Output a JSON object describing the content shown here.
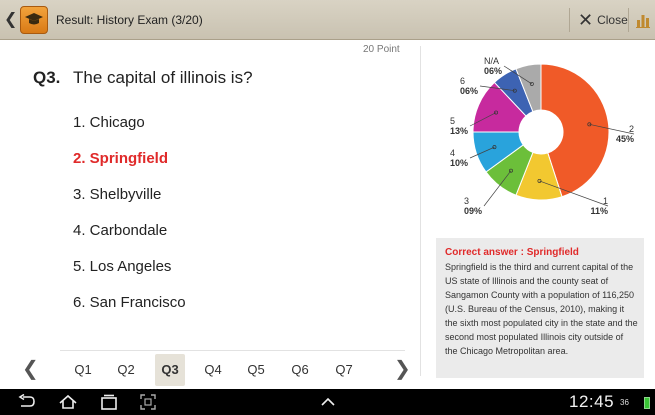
{
  "actionbar": {
    "title": "Result: History Exam (3/20)",
    "close_label": "Close",
    "back_icon": "chevron-left-icon",
    "app_icon": "graduation-cap-icon",
    "close_icon": "x-icon",
    "chart_icon": "bar-chart-icon"
  },
  "question": {
    "points": "20 Point",
    "number": "Q3.",
    "text": "The capital of illinois is?",
    "answers": [
      {
        "label": "1. Chicago",
        "correct": false
      },
      {
        "label": "2. Springfield",
        "correct": true
      },
      {
        "label": "3. Shelbyville",
        "correct": false
      },
      {
        "label": "4. Carbondale",
        "correct": false
      },
      {
        "label": "5. Los Angeles",
        "correct": false
      },
      {
        "label": "6. San Francisco",
        "correct": false
      }
    ]
  },
  "nav": {
    "prev_icon": "chevron-left-icon",
    "next_icon": "chevron-right-icon",
    "items": [
      "Q1",
      "Q2",
      "Q3",
      "Q4",
      "Q5",
      "Q6",
      "Q7"
    ],
    "active_index": 2
  },
  "chart_data": {
    "type": "pie",
    "donut": true,
    "slices": [
      {
        "label": "2",
        "percent_label": "45%",
        "value": 45,
        "color": "#f05a28"
      },
      {
        "label": "1",
        "percent_label": "11%",
        "value": 11,
        "color": "#f2c830"
      },
      {
        "label": "3",
        "percent_label": "09%",
        "value": 9,
        "color": "#6cbf3a"
      },
      {
        "label": "4",
        "percent_label": "10%",
        "value": 10,
        "color": "#29a3dc"
      },
      {
        "label": "5",
        "percent_label": "13%",
        "value": 13,
        "color": "#c72a9e"
      },
      {
        "label": "6",
        "percent_label": "06%",
        "value": 6,
        "color": "#3d63b3"
      },
      {
        "label": "N/A",
        "percent_label": "06%",
        "value": 6,
        "color": "#aaaaaa"
      }
    ]
  },
  "info": {
    "title": "Correct answer : Springfield",
    "body": "Springfield is the third and current capital of the US state of Illinois and the county seat of Sangamon County with a population of 116,250 (U.S. Bureau of the Census, 2010), making it the sixth most populated city in the state and the second most populated Illinois city outside of the Chicago Metropolitan area."
  },
  "sysbar": {
    "clock": "12:45",
    "status": "36",
    "back_icon": "back-arrow-icon",
    "home_icon": "home-icon",
    "recents_icon": "recent-apps-icon",
    "screenshot_icon": "screenshot-icon",
    "up_icon": "chevron-up-icon"
  }
}
